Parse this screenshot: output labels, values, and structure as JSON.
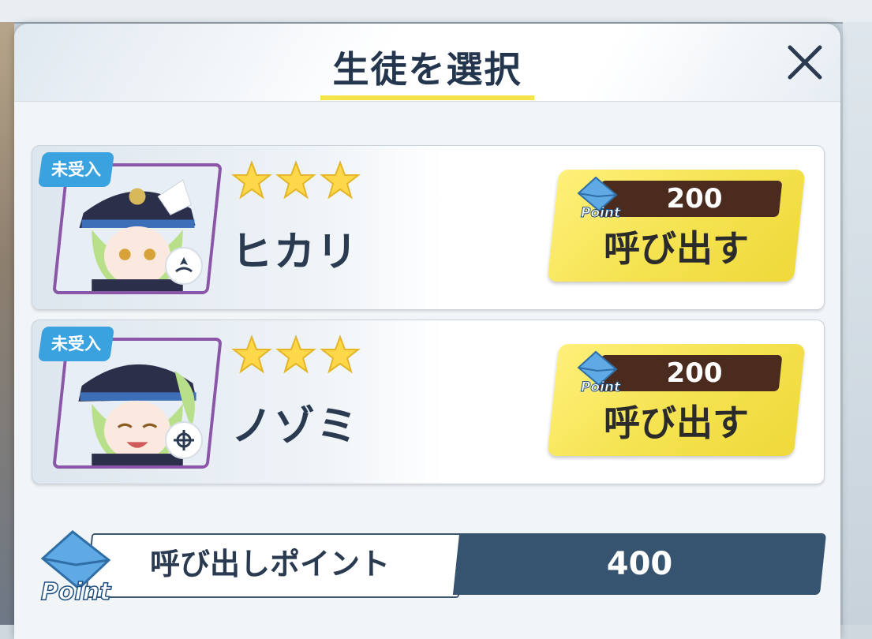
{
  "dialog": {
    "title": "生徒を選択",
    "close_icon": "close-icon"
  },
  "badge_text": "未受入",
  "students": [
    {
      "name": "ヒカリ",
      "stars": 3,
      "status": "未受入",
      "role_icon": "support-role-icon",
      "cost": "200",
      "call_label": "呼び出す",
      "point_label": "Point"
    },
    {
      "name": "ノゾミ",
      "stars": 3,
      "status": "未受入",
      "role_icon": "crosshair-role-icon",
      "cost": "200",
      "call_label": "呼び出す",
      "point_label": "Point"
    }
  ],
  "points": {
    "label": "呼び出しポイント",
    "value": "400",
    "icon_label": "Point"
  },
  "colors": {
    "accent_yellow": "#f5e34a",
    "cost_bar": "#4b2b1e",
    "points_bar": "#36536f",
    "badge_blue": "#3aa3df",
    "portrait_frame": "#8c56a8"
  }
}
